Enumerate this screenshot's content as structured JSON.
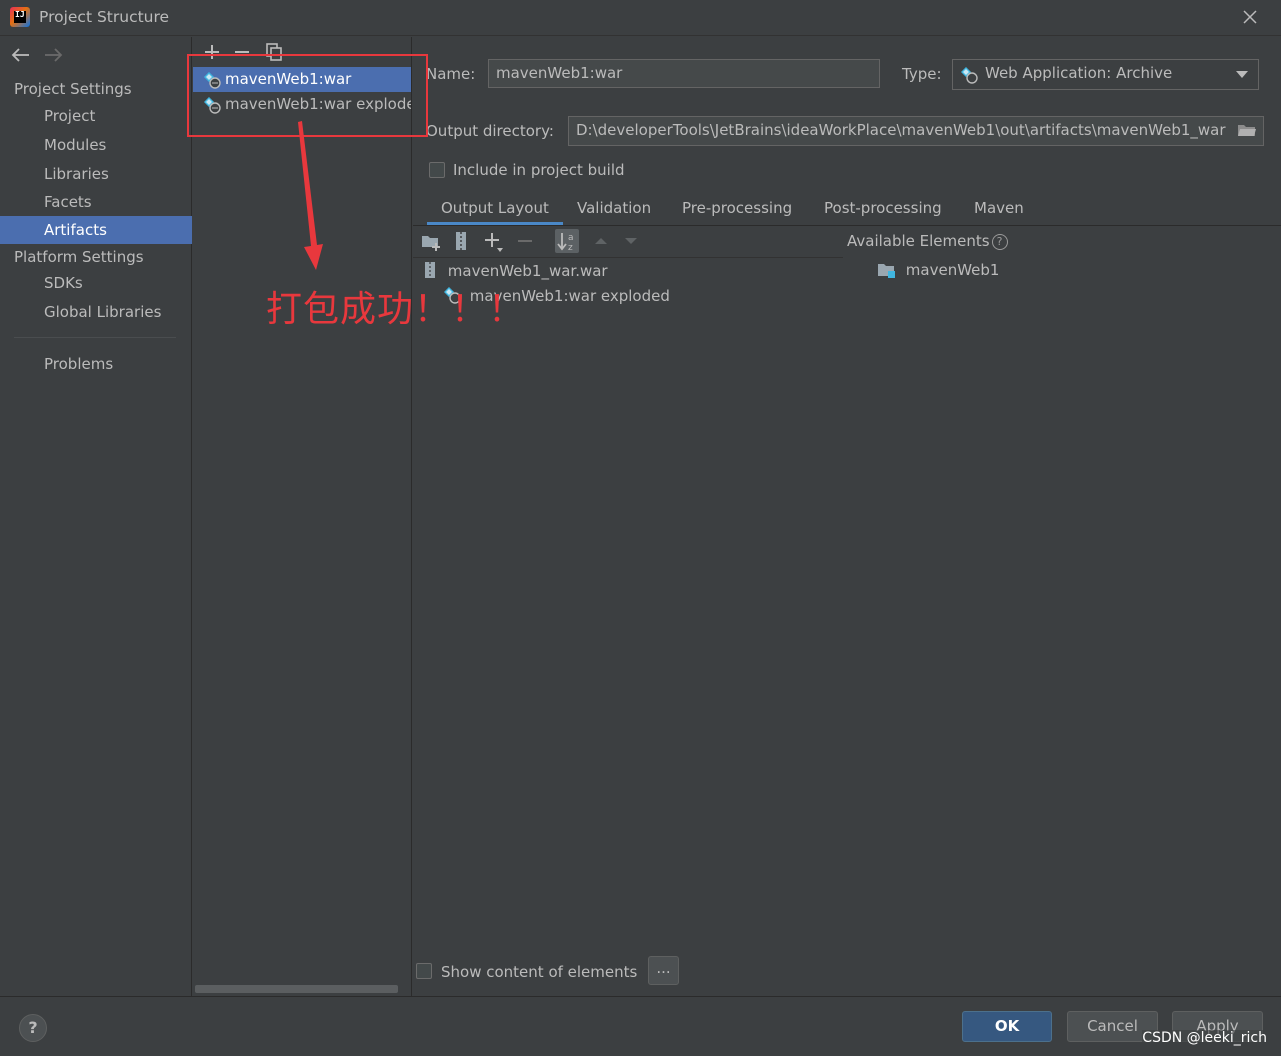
{
  "window": {
    "title": "Project Structure"
  },
  "nav": {
    "project_settings": "Project Settings",
    "items_ps": [
      "Project",
      "Modules",
      "Libraries",
      "Facets",
      "Artifacts"
    ],
    "platform_settings": "Platform Settings",
    "items_pl": [
      "SDKs",
      "Global Libraries"
    ],
    "problems": "Problems",
    "selected": "Artifacts"
  },
  "artifacts": {
    "items": [
      "mavenWeb1:war",
      "mavenWeb1:war explode"
    ],
    "selected": "mavenWeb1:war"
  },
  "annotation": {
    "text": "打包成功！！！"
  },
  "form": {
    "name_label": "Name:",
    "name_value": "mavenWeb1:war",
    "type_label": "Type:",
    "type_value": "Web Application: Archive",
    "output_label": "Output directory:",
    "output_value": "D:\\developerTools\\JetBrains\\ideaWorkPlace\\mavenWeb1\\out\\artifacts\\mavenWeb1_war",
    "include_label": "Include in project build"
  },
  "tabs": [
    "Output Layout",
    "Validation",
    "Pre-processing",
    "Post-processing",
    "Maven"
  ],
  "layout": {
    "root": "mavenWeb1_war.war",
    "child": "mavenWeb1:war exploded",
    "available_title": "Available Elements",
    "available_item": "mavenWeb1",
    "show_content_label": "Show content of elements",
    "dots": "..."
  },
  "buttons": {
    "ok": "OK",
    "cancel": "Cancel",
    "apply": "Apply",
    "help": "?"
  },
  "watermark": "CSDN @leeki_rich",
  "colors": {
    "selection": "#4b6eaf",
    "annotation": "#e8383d",
    "ok_button": "#365880"
  }
}
